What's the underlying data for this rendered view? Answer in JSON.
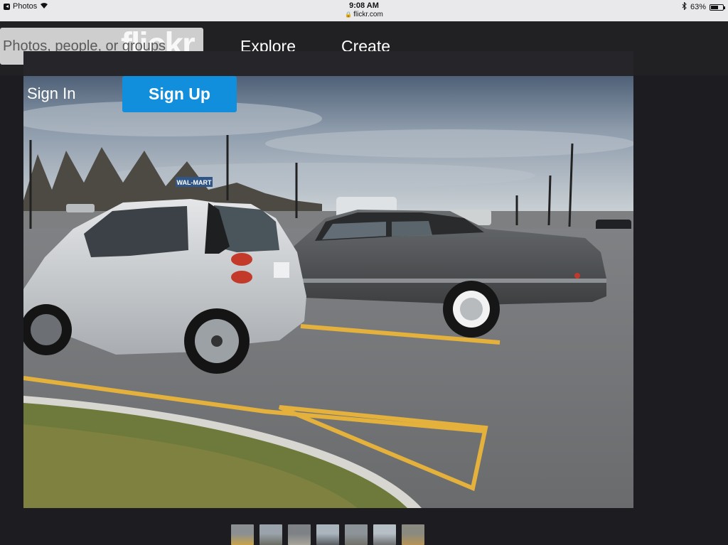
{
  "status_bar": {
    "back_app": "Photos",
    "time": "9:08 AM",
    "url": "flickr.com",
    "battery": "63%",
    "battery_level": 0.63
  },
  "header": {
    "logo": "flickr",
    "search_placeholder": "Photos, people, or groups",
    "nav": {
      "explore": "Explore",
      "create": "Create"
    }
  },
  "auth": {
    "sign_in": "Sign In",
    "sign_up": "Sign Up"
  },
  "photo": {
    "store_sign": "WAL-MART"
  },
  "thumbnails": [
    {
      "name": "thumb-1",
      "colors": [
        "#8b8f92",
        "#c8a34a"
      ]
    },
    {
      "name": "thumb-2",
      "colors": [
        "#9aa3ab",
        "#6a6b63"
      ]
    },
    {
      "name": "thumb-3",
      "colors": [
        "#7e8286",
        "#a7a49a"
      ]
    },
    {
      "name": "thumb-4",
      "colors": [
        "#a9b4bd",
        "#585c60"
      ]
    },
    {
      "name": "thumb-5",
      "colors": [
        "#8d9499",
        "#72706a"
      ]
    },
    {
      "name": "thumb-6",
      "colors": [
        "#b6bec6",
        "#6d6f70"
      ]
    },
    {
      "name": "thumb-7",
      "colors": [
        "#8a8a80",
        "#b69356"
      ]
    }
  ],
  "colors": {
    "accent": "#128fdc",
    "header_bg": "#212124",
    "page_bg": "#1c1c21"
  }
}
